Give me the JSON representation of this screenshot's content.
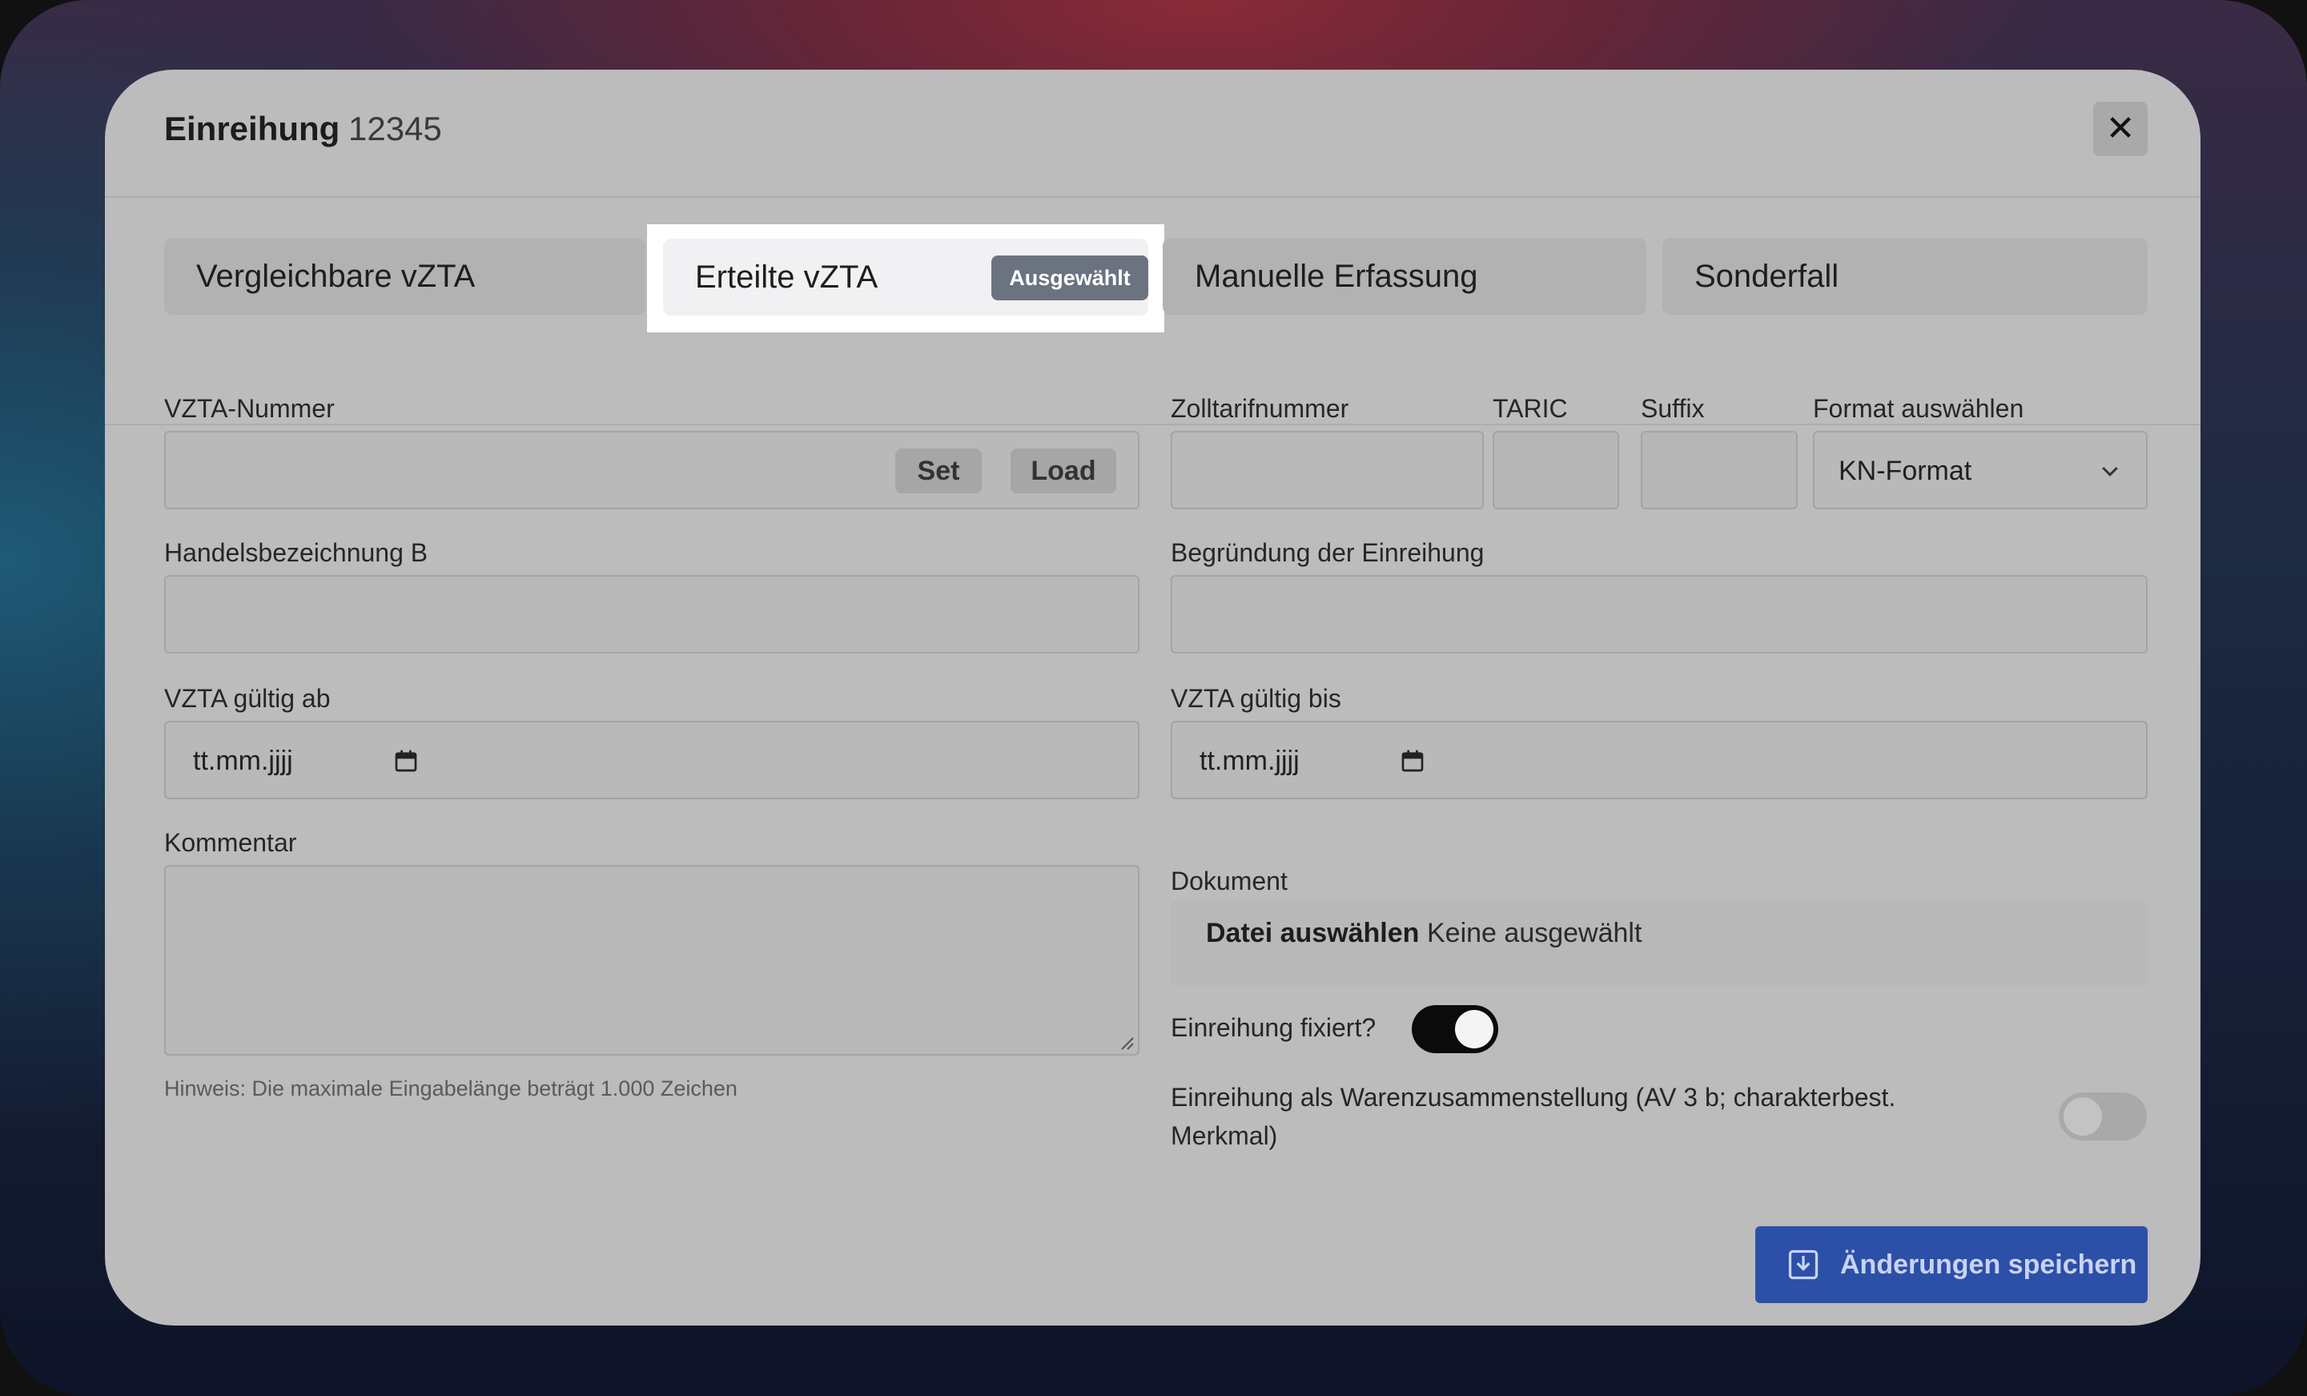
{
  "modal": {
    "title": "Einreihung",
    "id": "12345",
    "close_label": "✕"
  },
  "tabs": [
    {
      "label": "Vergleichbare vZTA"
    },
    {
      "label": "Erteilte vZTA",
      "badge": "Ausgewählt",
      "selected": true
    },
    {
      "label": "Manuelle Erfassung"
    },
    {
      "label": "Sonderfall"
    }
  ],
  "form": {
    "vzta_nummer": {
      "label": "VZTA-Nummer",
      "value": "",
      "set_label": "Set",
      "load_label": "Load"
    },
    "zolltarifnummer": {
      "label": "Zolltarifnummer",
      "value": ""
    },
    "taric": {
      "label": "TARIC",
      "value": ""
    },
    "suffix": {
      "label": "Suffix",
      "value": ""
    },
    "format": {
      "label": "Format auswählen",
      "selected": "KN-Format"
    },
    "handelsbezeichnung": {
      "label": "Handelsbezeichnung B",
      "value": ""
    },
    "begruendung": {
      "label": "Begründung der Einreihung",
      "value": ""
    },
    "gueltig_ab": {
      "label": "VZTA gültig ab",
      "placeholder": "tt.mm.jjjj"
    },
    "gueltig_bis": {
      "label": "VZTA gültig bis",
      "placeholder": "tt.mm.jjjj"
    },
    "kommentar": {
      "label": "Kommentar",
      "value": "",
      "hint": "Hinweis: Die maximale Eingabelänge beträgt 1.000 Zeichen"
    },
    "dokument": {
      "label": "Dokument",
      "button": "Datei auswählen",
      "status": "Keine ausgewählt"
    },
    "fixiert": {
      "label": "Einreihung fixiert?",
      "on": true
    },
    "warenzusammenstellung": {
      "label_line1": "Einreihung als Warenzusammenstellung (AV 3 b; charakterbest.",
      "label_line2": "Merkmal)",
      "on": false
    }
  },
  "actions": {
    "save_label": "Änderungen speichern"
  },
  "colors": {
    "primary": "#2c4fa8",
    "badge": "#6b7280",
    "overlay": "#bcbcbc"
  }
}
